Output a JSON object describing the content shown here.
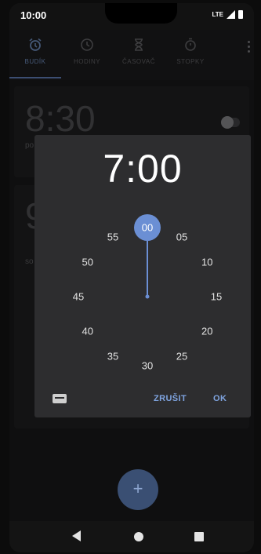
{
  "status_bar": {
    "time": "10:00",
    "network": "LTE"
  },
  "tabs": [
    {
      "label": "BUDÍK",
      "icon": "alarm-icon",
      "active": true
    },
    {
      "label": "HODINY",
      "icon": "clock-icon",
      "active": false
    },
    {
      "label": "ČASOVAČ",
      "icon": "hourglass-icon",
      "active": false
    },
    {
      "label": "STOPKY",
      "icon": "stopwatch-icon",
      "active": false
    }
  ],
  "alarms": [
    {
      "time": "8:30",
      "subtitle": "po"
    },
    {
      "time": "9",
      "subtitle": "so"
    }
  ],
  "time_picker": {
    "hour": "7",
    "separator": ":",
    "minute": "00",
    "selected_minute": "00",
    "dial_minutes": [
      "00",
      "05",
      "10",
      "15",
      "20",
      "25",
      "30",
      "35",
      "40",
      "45",
      "50",
      "55"
    ],
    "cancel_label": "ZRUŠIT",
    "ok_label": "OK"
  },
  "fab_label": "+",
  "colors": {
    "accent": "#7fa4e0",
    "selector": "#6b8fd4",
    "dialog_bg": "#2d2d2f",
    "background": "#1c1c1e"
  }
}
